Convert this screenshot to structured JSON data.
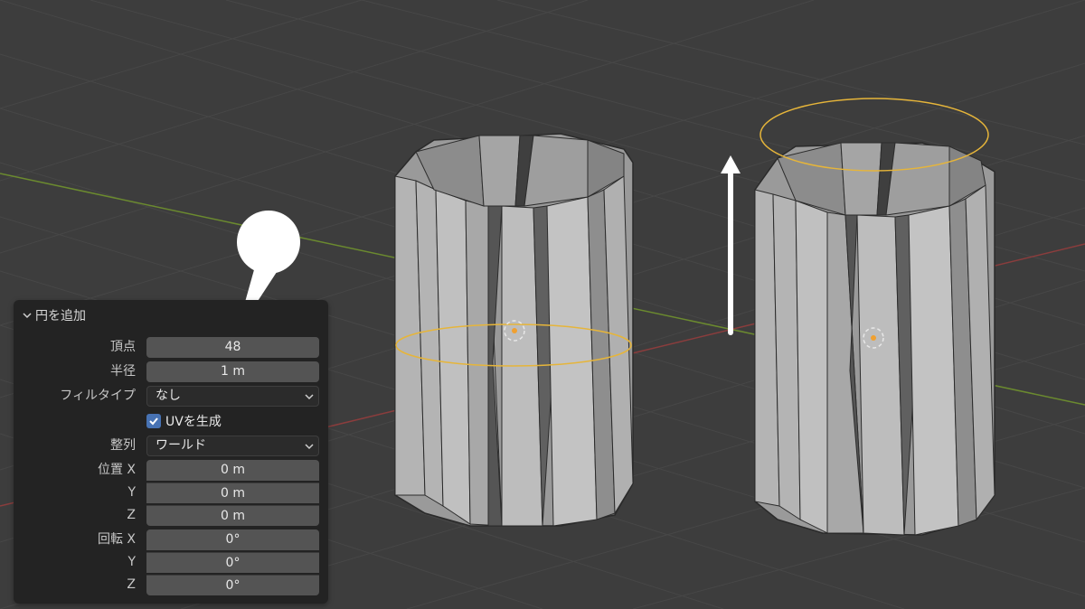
{
  "panel": {
    "title": "円を追加",
    "fields": {
      "vertices_label": "頂点",
      "vertices_value": "48",
      "radius_label": "半径",
      "radius_value": "1 m",
      "fill_type_label": "フィルタイプ",
      "fill_type_value": "なし",
      "generate_uv_label": "UVを生成",
      "generate_uv_checked": true,
      "align_label": "整列",
      "align_value": "ワールド",
      "location_label": "位置 X",
      "location_x": "0 m",
      "y_label": "Y",
      "location_y": "0 m",
      "z_label": "Z",
      "location_z": "0 m",
      "rotation_label": "回転 X",
      "rotation_x": "0°",
      "rot_y_label": "Y",
      "rotation_y": "0°",
      "rot_z_label": "Z",
      "rotation_z": "0°"
    }
  },
  "colors": {
    "background": "#3d3d3d",
    "panel_bg": "#232323",
    "field_bg": "#545454",
    "checkbox_accent": "#4772b3",
    "selection_outline": "#e6b53a",
    "x_axis": "#8a3d3d",
    "y_axis": "#6b8a2f"
  },
  "icons": [
    "chevron-down-icon",
    "checkmark-icon",
    "origin-icon",
    "move-up-arrow",
    "speech-bubble-callout"
  ]
}
